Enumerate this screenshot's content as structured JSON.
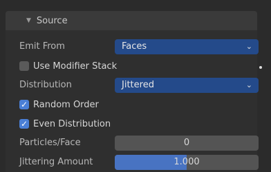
{
  "panel": {
    "title": "Source",
    "chevron": "▼"
  },
  "emit_from": {
    "label": "Emit From",
    "value": "Faces"
  },
  "use_modifier_stack": {
    "label": "Use Modifier Stack",
    "checked": false
  },
  "distribution": {
    "label": "Distribution",
    "value": "Jittered"
  },
  "random_order": {
    "label": "Random Order",
    "checked": true
  },
  "even_distribution": {
    "label": "Even Distribution",
    "checked": true
  },
  "particles_per_face": {
    "label": "Particles/Face",
    "value": "0"
  },
  "jittering_amount": {
    "label": "Jittering Amount",
    "value": "1.000",
    "fill_fraction": 0.5
  },
  "colors": {
    "accent_blue": "#4a7fd6",
    "dropdown_blue": "#244a8a",
    "panel_bg": "#2f2f2f"
  }
}
